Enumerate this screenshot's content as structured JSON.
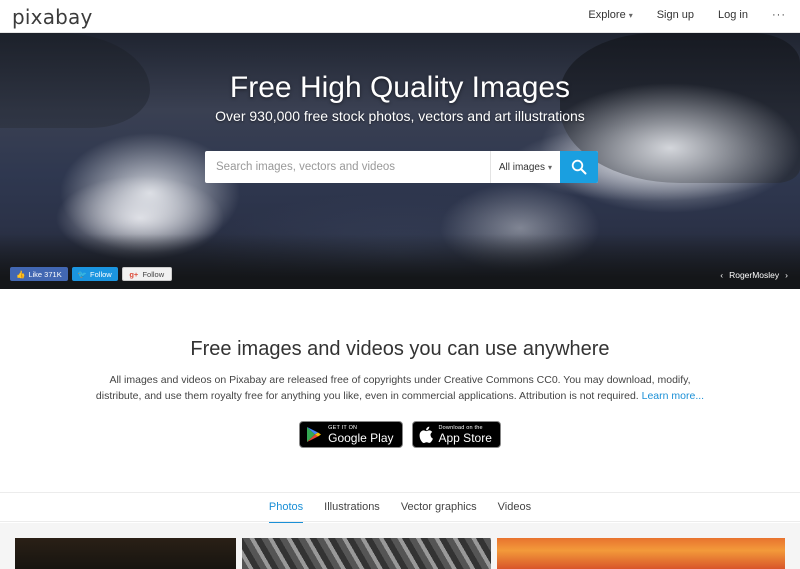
{
  "header": {
    "logo": "pixabay",
    "nav": {
      "explore": "Explore",
      "signup": "Sign up",
      "login": "Log in",
      "more": "···"
    }
  },
  "hero": {
    "title": "Free High Quality Images",
    "subtitle": "Over 930,000 free stock photos, vectors and art illustrations",
    "search": {
      "placeholder": "Search images, vectors and videos",
      "type": "All images"
    },
    "social": {
      "facebook": "Like 371K",
      "twitter": "Follow",
      "google": "Follow"
    },
    "credit": "RogerMosley"
  },
  "intro": {
    "title": "Free images and videos you can use anywhere",
    "text": "All images and videos on Pixabay are released free of copyrights under Creative Commons CC0. You may download, modify, distribute, and use them royalty free for anything you like, even in commercial applications. Attribution is not required.",
    "learn_more": "Learn more...",
    "google_play": {
      "small": "GET IT ON",
      "big": "Google Play"
    },
    "app_store": {
      "small": "Download on the",
      "big": "App Store"
    }
  },
  "tabs": [
    "Photos",
    "Illustrations",
    "Vector graphics",
    "Videos"
  ],
  "colors": {
    "accent": "#1a9fe0",
    "link": "#1a8fd6"
  }
}
